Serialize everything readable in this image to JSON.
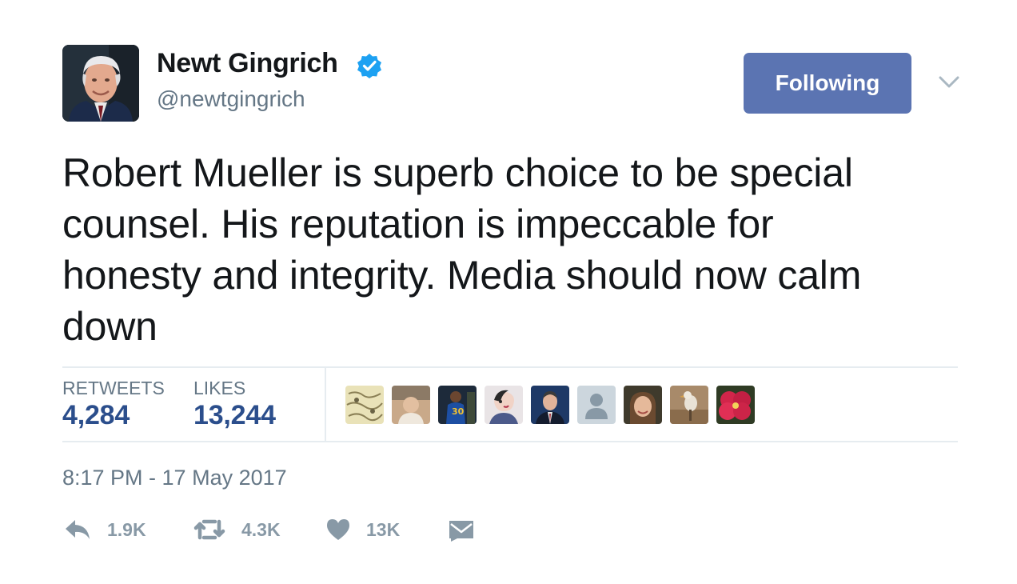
{
  "user": {
    "name": "Newt Gingrich",
    "handle": "@newtgingrich",
    "verified": true,
    "avatar_icon": "profile-photo"
  },
  "follow_button": {
    "label": "Following",
    "color": "#5b74b2"
  },
  "tweet": {
    "lines": [
      "Robert Mueller is superb choice to be special",
      "counsel. His reputation is impeccable for",
      "honesty and integrity. Media should now calm",
      "down"
    ],
    "timestamp": "8:17 PM - 17 May 2017"
  },
  "stats": {
    "retweets_label": "RETWEETS",
    "retweets_value": "4,284",
    "likes_label": "LIKES",
    "likes_value": "13,244"
  },
  "likers": [
    {
      "icon": "map-avatar"
    },
    {
      "icon": "photo-avatar"
    },
    {
      "icon": "basketball-avatar"
    },
    {
      "icon": "illustration-avatar"
    },
    {
      "icon": "portrait-avatar"
    },
    {
      "icon": "default-person-avatar"
    },
    {
      "icon": "woman-avatar"
    },
    {
      "icon": "bird-avatar"
    },
    {
      "icon": "flower-avatar"
    }
  ],
  "actions": {
    "reply_count": "1.9K",
    "retweet_count": "4.3K",
    "like_count": "13K"
  },
  "colors": {
    "accent": "#2b4e8c",
    "muted": "#657786",
    "icon": "#8899a6"
  }
}
